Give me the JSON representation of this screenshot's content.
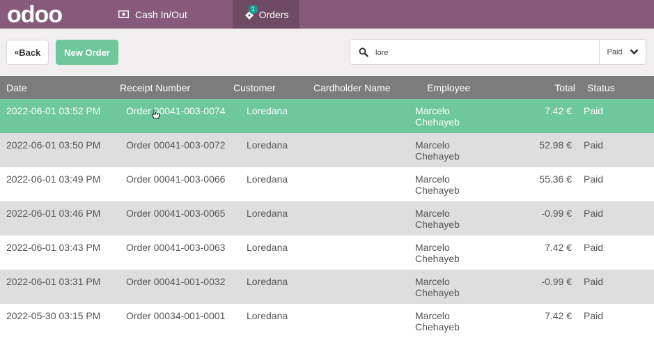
{
  "topbar": {
    "logo_text": "odoo",
    "cash_label": "Cash In/Out",
    "orders_label": "Orders",
    "orders_badge": "1"
  },
  "controls": {
    "back_label": "Back",
    "new_order_label": "New Order",
    "search_value": "lore",
    "filter_value": "Paid"
  },
  "table": {
    "headers": {
      "date": "Date",
      "receipt": "Receipt Number",
      "customer": "Customer",
      "cardholder": "Cardholder Name",
      "employee": "Employee",
      "total": "Total",
      "status": "Status"
    },
    "rows": [
      {
        "date": "2022-06-01 03:52 PM",
        "receipt": "Order 00041-003-0074",
        "customer": "Loredana",
        "cardholder": "",
        "employee": "Marcelo Chehayeb",
        "total": "7.42 €",
        "status": "Paid"
      },
      {
        "date": "2022-06-01 03:50 PM",
        "receipt": "Order 00041-003-0072",
        "customer": "Loredana",
        "cardholder": "",
        "employee": "Marcelo Chehayeb",
        "total": "52.98 €",
        "status": "Paid"
      },
      {
        "date": "2022-06-01 03:49 PM",
        "receipt": "Order 00041-003-0066",
        "customer": "Loredana",
        "cardholder": "",
        "employee": "Marcelo Chehayeb",
        "total": "55.36 €",
        "status": "Paid"
      },
      {
        "date": "2022-06-01 03:46 PM",
        "receipt": "Order 00041-003-0065",
        "customer": "Loredana",
        "cardholder": "",
        "employee": "Marcelo Chehayeb",
        "total": "-0.99 €",
        "status": "Paid"
      },
      {
        "date": "2022-06-01 03:43 PM",
        "receipt": "Order 00041-003-0063",
        "customer": "Loredana",
        "cardholder": "",
        "employee": "Marcelo Chehayeb",
        "total": "7.42 €",
        "status": "Paid"
      },
      {
        "date": "2022-06-01 03:31 PM",
        "receipt": "Order 00041-001-0032",
        "customer": "Loredana",
        "cardholder": "",
        "employee": "Marcelo Chehayeb",
        "total": "-0.99 €",
        "status": "Paid"
      },
      {
        "date": "2022-05-30 03:15 PM",
        "receipt": "Order 00034-001-0001",
        "customer": "Loredana",
        "cardholder": "",
        "employee": "Marcelo Chehayeb",
        "total": "7.42 €",
        "status": "Paid"
      }
    ]
  },
  "colors": {
    "topbar": "#875a7b",
    "active_tab": "#6f4a65",
    "accent_green": "#6ec89b",
    "header_gray": "#7c7c7c",
    "row_alt": "#dedede"
  },
  "icons": {
    "cash": "money-bill-icon",
    "orders": "ticket-icon",
    "search": "search-icon",
    "filter": "chevron-down-icon",
    "back": "double-chevron-left-icon",
    "cursor": "hand-pointer-icon"
  }
}
